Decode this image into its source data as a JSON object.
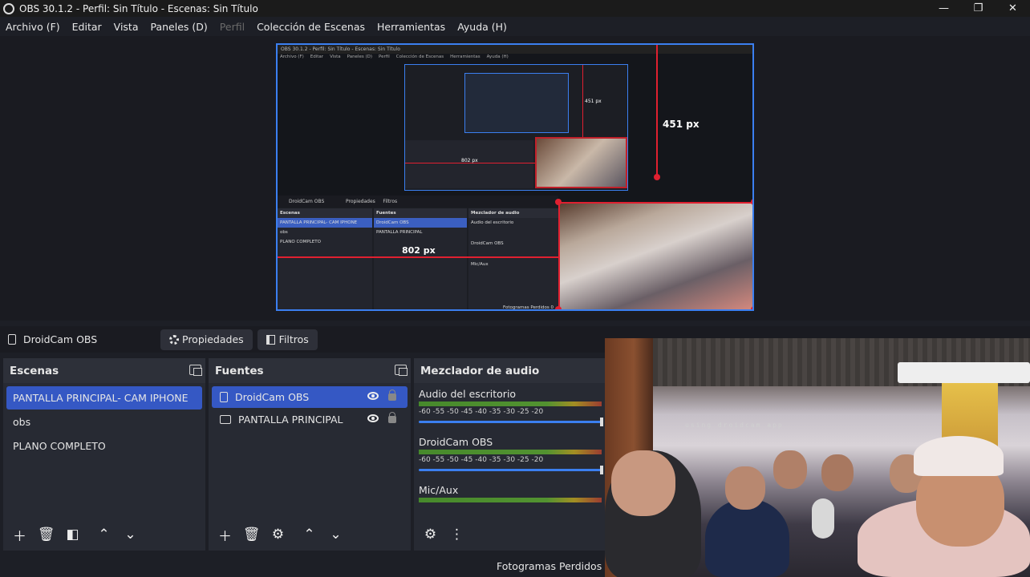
{
  "window": {
    "title": "OBS 30.1.2 - Perfil: Sin Título - Escenas: Sin Título",
    "minimize": "—",
    "maximize": "❐",
    "close": "✕"
  },
  "menu": {
    "items": [
      {
        "label": "Archivo (F)",
        "disabled": false
      },
      {
        "label": "Editar",
        "disabled": false
      },
      {
        "label": "Vista",
        "disabled": false
      },
      {
        "label": "Paneles (D)",
        "disabled": false
      },
      {
        "label": "Perfil",
        "disabled": true
      },
      {
        "label": "Colección de Escenas",
        "disabled": false
      },
      {
        "label": "Herramientas",
        "disabled": false
      },
      {
        "label": "Ayuda (H)",
        "disabled": false
      }
    ]
  },
  "preview": {
    "measure_vertical": "451 px",
    "measure_horizontal": "802 px",
    "mini_title": "OBS 30.1.2 - Perfil: Sin Título - Escenas: Sin Título",
    "mini_menu": [
      "Archivo (F)",
      "Editar",
      "Vista",
      "Paneles (D)",
      "Perfil",
      "Colección de Escenas",
      "Herramientas",
      "Ayuda (H)"
    ],
    "mini_source_name": "DroidCam OBS",
    "mini_properties": "Propiedades",
    "mini_filters": "Filtros",
    "mini_scenes_header": "Escenas",
    "mini_sources_header": "Fuentes",
    "mini_mixer_header": "Mezclador de audio",
    "mini_scenes": [
      "PANTALLA PRINCIPAL- CAM IPHONE",
      "obs",
      "PLANO COMPLETO"
    ],
    "mini_sources": [
      "DroidCam OBS",
      "PANTALLA PRINCIPAL"
    ],
    "mini_mixer": [
      "Audio del escritorio",
      "DroidCam OBS",
      "Mic/Aux"
    ],
    "mini_status": "Fotogramas Perdidos 0",
    "mini_nested_label_v": "451 px",
    "mini_nested_label_h": "802 px"
  },
  "toolbar": {
    "source_name": "DroidCam OBS",
    "properties_label": "Propiedades",
    "filters_label": "Filtros"
  },
  "scenes": {
    "header": "Escenas",
    "items": [
      "PANTALLA PRINCIPAL- CAM IPHONE",
      "obs",
      "PLANO COMPLETO"
    ],
    "selected_index": 0
  },
  "sources": {
    "header": "Fuentes",
    "items": [
      {
        "name": "DroidCam OBS",
        "icon": "file-icon",
        "selected": true
      },
      {
        "name": "PANTALLA PRINCIPAL",
        "icon": "monitor-icon",
        "selected": false
      }
    ]
  },
  "mixer": {
    "header": "Mezclador de audio",
    "ticks": "-60  -55  -50  -45  -40  -35  -30  -25  -20",
    "channels": [
      {
        "name": "Audio del escritorio"
      },
      {
        "name": "DroidCam OBS"
      },
      {
        "name": "Mic/Aux"
      }
    ]
  },
  "status": {
    "dropped_frames": "Fotogramas Perdidos 0"
  },
  "webcam": {
    "watermark": "using droidcam app"
  },
  "colors": {
    "accent": "#3558c4",
    "selection_border": "#3b7ff0",
    "measure": "#e02030"
  }
}
